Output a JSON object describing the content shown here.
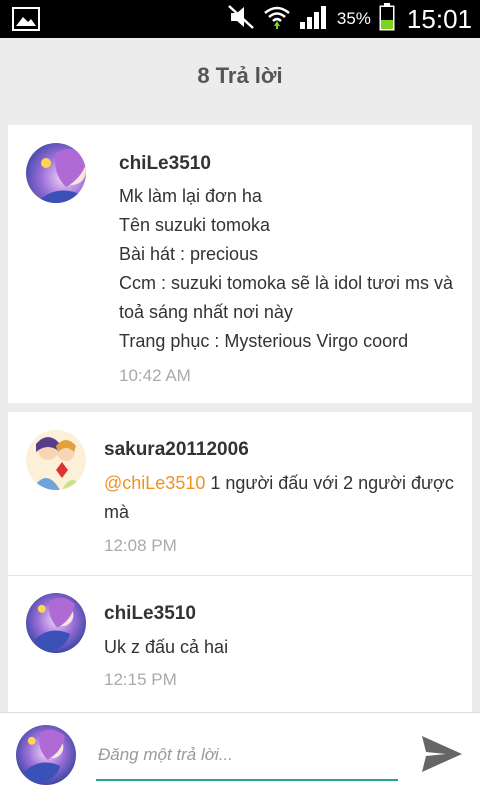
{
  "status_bar": {
    "battery_percent": "35%",
    "time": "15:01",
    "icons": [
      "image-icon",
      "mute-icon",
      "wifi-icon",
      "signal-icon",
      "battery-icon"
    ]
  },
  "header": {
    "title": "8 Trả lời"
  },
  "replies": [
    {
      "username": "chiLe3510",
      "lines": [
        "Mk làm lại đơn ha",
        "Tên suzuki tomoka",
        "Bài hát : precious",
        "Ccm : suzuki tomoka sẽ là idol tươi ms và",
        "toả sáng nhất nơi này",
        "Trang phục : Mysterious Virgo coord"
      ],
      "time": "10:42 AM"
    },
    {
      "username": "sakura20112006",
      "mention": "@chiLe3510",
      "line1_rest": " 1 người đấu với 2 người được",
      "line2": "mà",
      "time": "12:08 PM"
    },
    {
      "username": "chiLe3510",
      "lines": [
        "Uk z đấu cả hai"
      ],
      "time": "12:15 PM"
    }
  ],
  "composer": {
    "placeholder": "Đăng một trả lời...",
    "accent": "#2aa198"
  },
  "colors": {
    "mention": "#f0921d",
    "background": "#ececec"
  }
}
